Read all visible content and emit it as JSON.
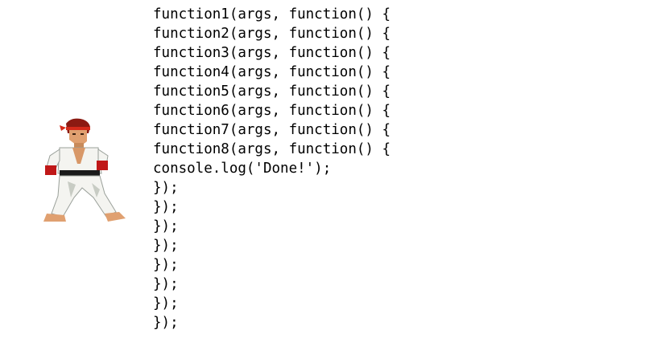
{
  "code": {
    "lines": [
      "function1(args, function() {",
      "function2(args, function() {",
      "function3(args, function() {",
      "function4(args, function() {",
      "function5(args, function() {",
      "function6(args, function() {",
      "function7(args, function() {",
      "function8(args, function() {",
      "console.log('Done!');",
      "});",
      "});",
      "});",
      "});",
      "});",
      "});",
      "});",
      "});"
    ]
  },
  "fighter": {
    "icon": "karate-fighter-icon",
    "colors": {
      "hair": "#8b1a12",
      "headband": "#d42a1a",
      "skin": "#e0a070",
      "gi": "#f4f4f0",
      "gi_shadow": "#c8ccc4",
      "belt": "#1a1a1a",
      "glove": "#c01818"
    }
  }
}
